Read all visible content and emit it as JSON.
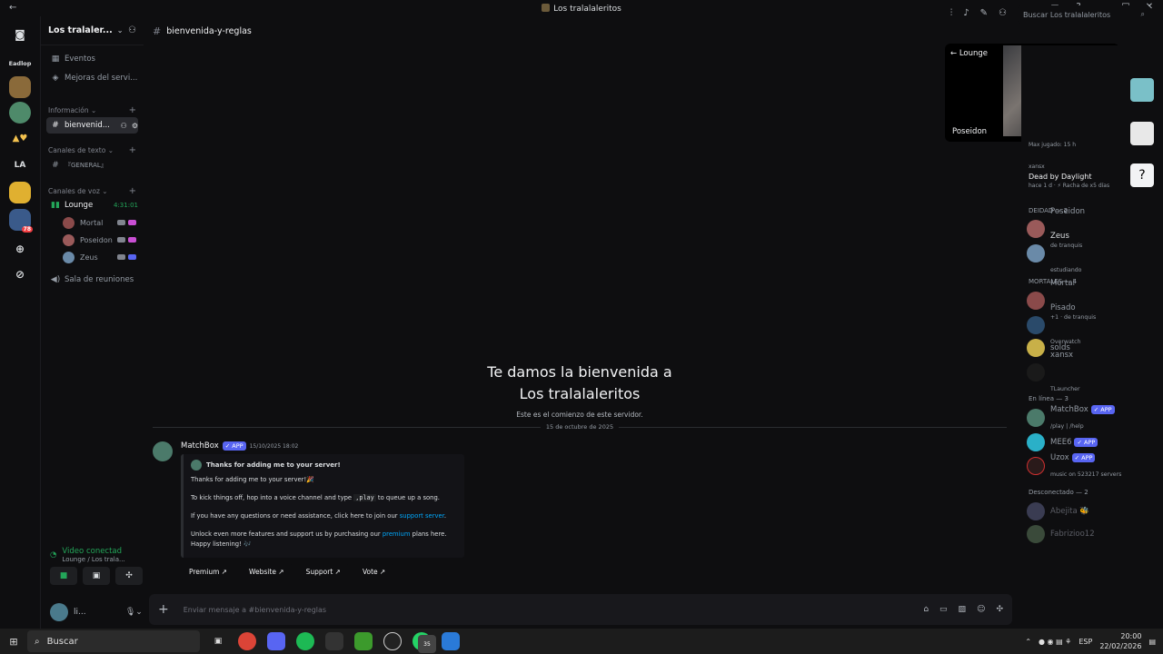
{
  "window": {
    "title": "Los tralalaleritos",
    "back_glyph": "←",
    "controls": [
      "▭",
      "?",
      "–",
      "□",
      "✕"
    ]
  },
  "rail": {
    "items": [
      {
        "label": "Eadlop"
      },
      {
        "label": "LA"
      },
      {
        "label": "78"
      }
    ]
  },
  "sidebar": {
    "guild_name": "Los tralaler...",
    "top_items": [
      {
        "label": "Eventos"
      },
      {
        "label": "Mejoras del servi..."
      }
    ],
    "categories": {
      "info": "Información",
      "text": "Canales de texto",
      "voice": "Canales de voz"
    },
    "channels": {
      "active": "bienvenid...",
      "general": "『GENERAL』"
    },
    "voice": {
      "channel": "Lounge",
      "timer": "4:31:01",
      "users": [
        {
          "name": "Mortal"
        },
        {
          "name": "Poseidon"
        },
        {
          "name": "Zeus"
        }
      ],
      "meeting": "Sala de reuniones"
    }
  },
  "voice_panel": {
    "status": "Video conectad",
    "location": "Lounge / Los trala..."
  },
  "user_panel": {
    "name": "li..."
  },
  "header": {
    "channel": "bienvenida-y-reglas",
    "search_placeholder": "Buscar Los tralalaleritos"
  },
  "chat": {
    "welcome_title_1": "Te damos la bienvenida a",
    "welcome_title_2": "Los tralalaleritos",
    "welcome_sub": "Este es el comienzo de este servidor.",
    "date_divider": "15 de octubre de 2025",
    "message": {
      "author": "MatchBox",
      "badge": "✓ APP",
      "time": "15/10/2025 18:02",
      "embed_title": "Thanks for adding me to your server!",
      "line1": "Thanks for adding me to your server!🎉",
      "line2_a": "To kick things off, hop into a voice channel and type",
      "line2_code": ",play",
      "line2_b": "to queue up a song.",
      "line3_a": "If you have any questions or need assistance, click here to join our",
      "line3_link": "support server",
      "line3_b": ".",
      "line4_a": "Unlock even more features and support us by purchasing our",
      "line4_link": "premium",
      "line4_b": "plans here.",
      "line5": "Happy listening! 🎶",
      "buttons": [
        "Premium ↗",
        "Website ↗",
        "Support ↗",
        "Vote ↗"
      ]
    },
    "composer_placeholder": "Enviar mensaje a #bienvenida-y-reglas"
  },
  "members": {
    "pip": {
      "back": "← Lounge",
      "name": "Poseidon"
    },
    "activity_top": {
      "max_played": "Max jugado: 15 h",
      "user": "xansx",
      "game": "Dead by Daylight",
      "detail": "hace 1 d · ⚡ Racha de x5 días"
    },
    "groups": [
      {
        "label": "DEIDAD — 2"
      },
      {
        "label": "MORTALES — 4"
      },
      {
        "label": "En línea — 3"
      },
      {
        "label": "Desconectado — 2"
      }
    ],
    "deidad": [
      {
        "name": "Poseidon",
        "activity": "de tranquis"
      },
      {
        "name": "Zeus",
        "activity": "estudiando"
      }
    ],
    "mortales": [
      {
        "name": "Mortal",
        "activity": "+1 · de tranquis"
      },
      {
        "name": "Pisado",
        "activity": "Overwatch"
      },
      {
        "name": "solds",
        "activity": ""
      },
      {
        "name": "xansx",
        "activity": "TLauncher"
      }
    ],
    "online": [
      {
        "name": "MatchBox",
        "badge": "✓ APP",
        "activity": "/play | /help"
      },
      {
        "name": "MEE6",
        "badge": "✓ APP",
        "activity": ""
      },
      {
        "name": "Uzox",
        "badge": "✓ APP",
        "activity": "music on 523217 servers"
      }
    ],
    "offline": [
      {
        "name": "Abejita 🐝"
      },
      {
        "name": "Fabrizioo12"
      }
    ]
  },
  "taskbar": {
    "search": "Buscar",
    "lang": "ESP",
    "time": "20:00",
    "date": "22/02/2026",
    "whatsapp_badge": "35"
  },
  "colors": {
    "accent": "#5865f2",
    "online": "#23a559",
    "link": "#00a8fc"
  }
}
